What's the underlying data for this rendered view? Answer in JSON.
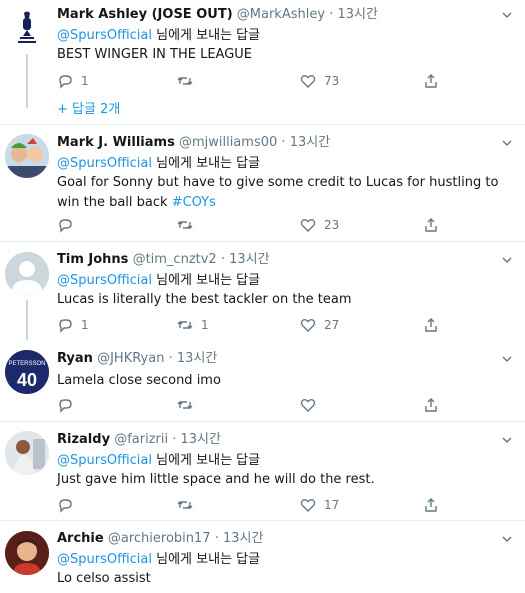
{
  "replying_prefix": "@SpursOfficial",
  "replying_suffix": " 님에게 보내는 답글",
  "dot": "·",
  "tweets": [
    {
      "name": "Mark Ashley (JOSE OUT)",
      "handle": "@MarkAshley",
      "time": "13시간",
      "text": "BEST WINGER IN THE LEAGUE",
      "hashtag": "",
      "replies": "1",
      "retweets": "",
      "likes": "73",
      "show_replies": "+ 답글 2개",
      "avatar": "spurs-crest"
    },
    {
      "name": "Mark J. Williams",
      "handle": "@mjwilliams00",
      "time": "13시간",
      "text": "Goal for Sonny but have to give some credit to Lucas for hustling to win the ball back ",
      "hashtag": "#COYs",
      "replies": "",
      "retweets": "",
      "likes": "23",
      "avatar": "photo"
    },
    {
      "name": "Tim Johns",
      "handle": "@tim_cnztv2",
      "time": "13시간",
      "text": "Lucas is literally the best tackler on the team",
      "hashtag": "",
      "replies": "1",
      "retweets": "1",
      "likes": "27",
      "avatar": "default"
    },
    {
      "name": "Ryan",
      "handle": "@JHKRyan",
      "time": "13시간",
      "text": "Lamela close second imo",
      "hashtag": "",
      "replies": "",
      "retweets": "",
      "likes": "",
      "avatar": "jersey",
      "avatar_text_top": "PETERSSON",
      "avatar_text_num": "40"
    },
    {
      "name": "Rizaldy",
      "handle": "@farizrii",
      "time": "13시간",
      "text": "Just gave him little space and he will do the rest.",
      "hashtag": "",
      "replies": "",
      "retweets": "",
      "likes": "17",
      "avatar": "photo"
    },
    {
      "name": "Archie",
      "handle": "@archierobin17",
      "time": "13시간",
      "text": "Lo celso assist",
      "hashtag": "",
      "avatar": "photo"
    }
  ],
  "colors": {
    "link": "#1b95e0",
    "muted": "#657786",
    "divider": "#e6ecf0",
    "thread_line": "#ccd6dd"
  }
}
